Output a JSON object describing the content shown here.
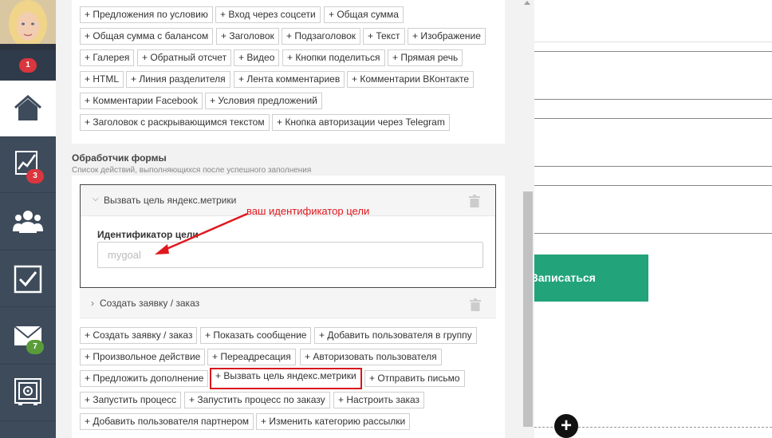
{
  "sidebar": {
    "avatar_alt": "",
    "notif_badge": "1",
    "items": [
      {
        "icon": "home-icon",
        "badge": ""
      },
      {
        "icon": "chart-icon",
        "badge": "3"
      },
      {
        "icon": "users-icon",
        "badge": ""
      },
      {
        "icon": "checkbox-icon",
        "badge": ""
      },
      {
        "icon": "mail-icon",
        "badge": "7"
      },
      {
        "icon": "safe-icon",
        "badge": ""
      }
    ]
  },
  "elements_palette": [
    "+ Предложения по условию",
    "+ Вход через соцсети",
    "+ Общая сумма",
    "+ Общая сумма с балансом",
    "+ Заголовок",
    "+ Подзаголовок",
    "+ Текст",
    "+ Изображение",
    "+ Галерея",
    "+ Обратный отсчет",
    "+ Видео",
    "+ Кнопки поделиться",
    "+ Прямая речь",
    "+ HTML",
    "+ Линия разделителя",
    "+ Лента комментариев",
    "+ Комментарии ВКонтакте",
    "+ Комментарии Facebook",
    "+ Условия предложений",
    "+ Заголовок с раскрывающимся текстом",
    "+ Кнопка авторизации через Telegram"
  ],
  "form_handler": {
    "title": "Обработчик формы",
    "subtitle": "Список действий, выполняющихся после успешного заполнения",
    "expanded_action": {
      "label": "Вызвать цель яндекс.метрики",
      "field_label": "Идентификатор цели",
      "field_placeholder": "mygoal",
      "field_value": ""
    },
    "collapsed_action": {
      "label": "Создать заявку / заказ"
    },
    "annotation": "ваш идентификатор цели",
    "add_actions": [
      "+ Создать заявку / заказ",
      "+ Показать сообщение",
      "+ Добавить пользователя в группу",
      "+ Произвольное действие",
      "+ Переадресация",
      "+ Авторизовать пользователя",
      "+ Предложить дополнение",
      "+ Вызвать цель яндекс.метрики",
      "+ Отправить письмо",
      "+ Запустить процесс",
      "+ Запустить процесс по заказу",
      "+ Настроить заказ",
      "+ Добавить пользователя партнером",
      "+ Изменить категорию рассылки"
    ],
    "highlighted_action": "+ Вызвать цель яндекс.метрики"
  },
  "preview": {
    "signup_button": "Записаться",
    "add_block_icon": "plus-circle-icon"
  },
  "colors": {
    "sidebar": "#3e4b5b",
    "accent_green": "#22a37a",
    "highlight_red": "#d8161c",
    "badge_red": "#d9363e",
    "badge_green": "#5a9c3a"
  }
}
